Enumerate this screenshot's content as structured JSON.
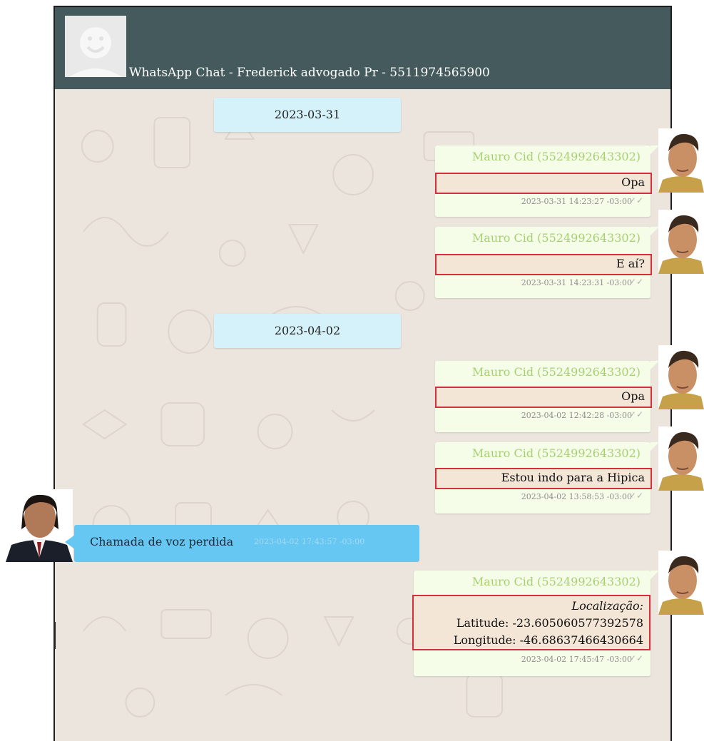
{
  "header": {
    "title": "WhatsApp Chat - Frederick advogado Pr - 5511974565900",
    "avatar_icon": "default-avatar-icon"
  },
  "colors": {
    "header_bg": "#445a5c",
    "outgoing_bubble": "#f5fde9",
    "incoming_bubble": "#66c7f2",
    "date_chip": "#d5f2fb",
    "highlight_border": "#d42f3a",
    "sender_name": "#a6d070"
  },
  "dates": [
    "2023-03-31",
    "2023-04-02"
  ],
  "messages": [
    {
      "sender": "Mauro Cid (5524992643302)",
      "text": "Opa",
      "timestamp": "2023-03-31 14:23:27 -03:00",
      "status_icon": "double-check-icon"
    },
    {
      "sender": "Mauro Cid (5524992643302)",
      "text": "E aí?",
      "timestamp": "2023-03-31 14:23:31 -03:00",
      "status_icon": "double-check-icon"
    },
    {
      "sender": "Mauro Cid (5524992643302)",
      "text": "Opa",
      "timestamp": "2023-04-02 12:42:28 -03:00",
      "status_icon": "double-check-icon"
    },
    {
      "sender": "Mauro Cid (5524992643302)",
      "text": "Estou indo para a Hipica",
      "timestamp": "2023-04-02 13:58:53 -03:00",
      "status_icon": "double-check-icon"
    },
    {
      "sender": "Mauro Cid (5524992643302)",
      "location_label": "Localização:",
      "latitude": "Latitude: -23.605060577392578",
      "longitude": "Longitude: -46.68637466430664",
      "timestamp": "2023-04-02 17:45:47 -03:00",
      "status_icon": "double-check-icon"
    }
  ],
  "incoming": {
    "text": "Chamada de voz perdida",
    "timestamp": "2023-04-02 17:43:57 -03:00"
  },
  "ticks_glyph": "✓✓"
}
